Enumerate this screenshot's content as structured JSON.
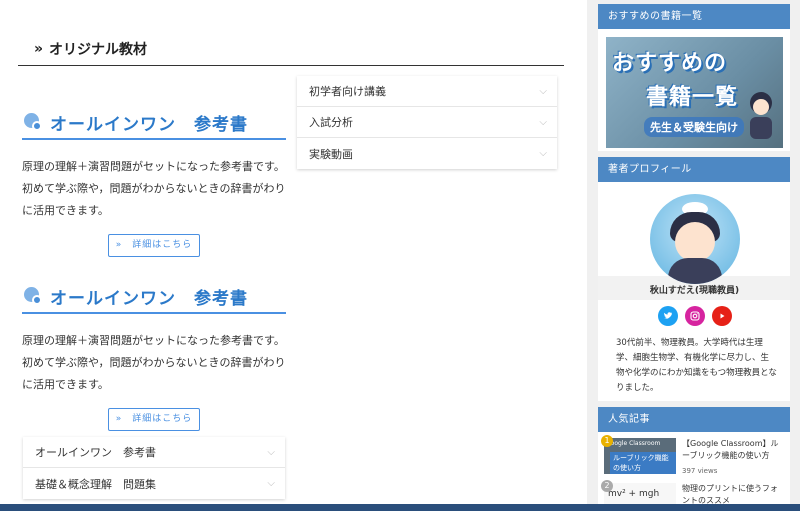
{
  "main": {
    "section_title": "オリジナル教材",
    "section_arrow": "»",
    "blocks": [
      {
        "heading": "オールインワン　参考書",
        "description": "原理の理解＋演習問題がセットになった参考書です。初めて学ぶ際や，問題がわからないときの辞書がわりに活用できます。",
        "button": "»　詳細はこちら"
      },
      {
        "heading": "オールインワン　参考書",
        "description": "原理の理解＋演習問題がセットになった参考書です。初めて学ぶ際や，問題がわからないときの辞書がわりに活用できます。",
        "button": "»　詳細はこちら"
      }
    ],
    "right_accordion": [
      "初学者向け講義",
      "入試分析",
      "実験動画"
    ],
    "bottom_accordion": [
      "オールインワン　参考書",
      "基礎＆概念理解　問題集"
    ]
  },
  "sidebar": {
    "books": {
      "header": "おすすめの書籍一覧",
      "banner_line1": "おすすめの",
      "banner_line2": "書籍一覧",
      "banner_sub": "先生＆受験生向け"
    },
    "profile": {
      "header": "著者プロフィール",
      "name": "秋山すだえ(現職教員)",
      "bio": "30代前半、物理教員。大学時代は生理学、細胞生物学、有機化学に尽力し、生物や化学のにわか知識をもつ物理教員となりました。",
      "social_icons": [
        "twitter-icon",
        "instagram-icon",
        "youtube-icon"
      ]
    },
    "popular": {
      "header": "人気記事",
      "items": [
        {
          "rank": "1",
          "thumb_text": "Google Classroom",
          "thumb_sub": "ルーブリック機能の使い方",
          "title": "【Google Classroom】ルーブリック機能の使い方",
          "views": "397 views"
        },
        {
          "rank": "2",
          "thumb_text": "mv² + mgh",
          "title": "物理のプリントに使うフォントのススメ",
          "views": ""
        }
      ]
    }
  },
  "colors": {
    "accent": "#4a90e2",
    "sidebar_header": "#4d88c4",
    "heading_text": "#2b79c9"
  }
}
